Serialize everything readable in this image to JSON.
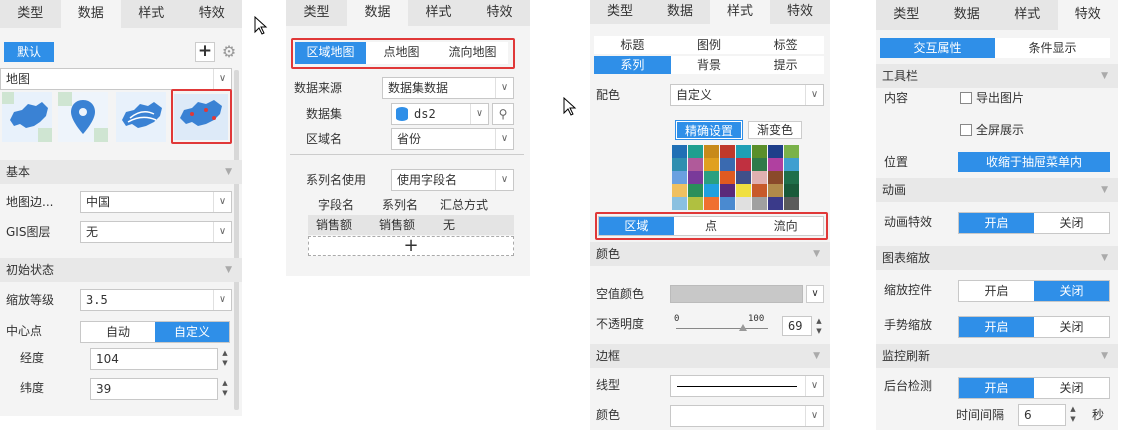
{
  "p1": {
    "tabs": [
      "类型",
      "数据",
      "样式",
      "特效"
    ],
    "default_label": "默认",
    "plus_icon": "plus-icon",
    "gear_icon": "gear-icon",
    "map_select": "地图",
    "map_types": [
      {
        "icon": "china-map-region-icon"
      },
      {
        "icon": "map-pin-icon"
      },
      {
        "icon": "china-map-flow-icon"
      },
      {
        "icon": "china-map-points-icon"
      }
    ],
    "basic": "基本",
    "boundary_label": "地图边...",
    "boundary_value": "中国",
    "gis_label": "GIS图层",
    "gis_value": "无",
    "init": "初始状态",
    "zoom_label": "缩放等级",
    "zoom_value": "3.5",
    "center_label": "中心点",
    "center_auto": "自动",
    "center_custom": "自定义",
    "lon_label": "经度",
    "lon_value": "104",
    "lat_label": "纬度",
    "lat_value": "39"
  },
  "p2": {
    "tabs": [
      "类型",
      "数据",
      "样式",
      "特效"
    ],
    "subtabs": [
      "区域地图",
      "点地图",
      "流向地图"
    ],
    "source_label": "数据来源",
    "source_value": "数据集数据",
    "dataset_label": "数据集",
    "dataset_value": "ds2",
    "region_label": "区域名",
    "region_value": "省份",
    "series_label": "系列名使用",
    "series_value": "使用字段名",
    "table_headers": [
      "字段名",
      "系列名",
      "汇总方式"
    ],
    "table_row": [
      "销售额",
      "销售额",
      "无"
    ],
    "add": "+"
  },
  "p3": {
    "tabs": [
      "类型",
      "数据",
      "样式",
      "特效"
    ],
    "grid": [
      "标题",
      "图例",
      "标签",
      "系列",
      "背景",
      "提示"
    ],
    "color_label": "配色",
    "color_value": "自定义",
    "precise": "精确设置",
    "gradient": "渐变色",
    "palette": [
      "#1f6fb5",
      "#1f9f8f",
      "#c88a1a",
      "#c0392b",
      "#1f9fb5",
      "#5a8f2a",
      "#1f3f8a",
      "#7ab24a",
      "#2f8fb0",
      "#b05a9a",
      "#e0a020",
      "#3a6ab0",
      "#c03040",
      "#307a4a",
      "#b040a0",
      "#3f9fd0",
      "#6aa0e0",
      "#7a3a9a",
      "#2aa080",
      "#e05a20",
      "#40508a",
      "#e0b0b0",
      "#8a4a2a",
      "#1f6f4a",
      "#f0c060",
      "#2a8f5a",
      "#20a0e0",
      "#5a2a7a",
      "#f0e040",
      "#c85a2a",
      "#b08a4a",
      "#1a5a3a",
      "#8ac0e0",
      "#b0c040",
      "#f07030",
      "#4a8ad0",
      "#e0e0e0",
      "#a0a0a0",
      "#3a3a8a",
      "#5a5a5a"
    ],
    "region_tabs": [
      "区域",
      "点",
      "流向"
    ],
    "color_sec": "颜色",
    "empty_label": "空值颜色",
    "opacity_label": "不透明度",
    "slider_min": "0",
    "slider_max": "100",
    "opacity_value": "69",
    "border_sec": "边框",
    "line_label": "线型",
    "bcolor_label": "颜色"
  },
  "p4": {
    "tabs": [
      "类型",
      "数据",
      "样式",
      "特效"
    ],
    "sub": [
      "交互属性",
      "条件显示"
    ],
    "toolbar_sec": "工具栏",
    "content_label": "内容",
    "export_label": "导出图片",
    "fullscreen_label": "全屏展示",
    "position_label": "位置",
    "position_value": "收缩于抽屉菜单内",
    "anim_sec": "动画",
    "anim_label": "动画特效",
    "on": "开启",
    "off": "关闭",
    "zoom_sec": "图表缩放",
    "zoomctl_label": "缩放控件",
    "gesture_label": "手势缩放",
    "refresh_sec": "监控刷新",
    "bg_label": "后台检测",
    "interval_label": "时间间隔",
    "interval_value": "6",
    "sec_unit": "秒"
  }
}
